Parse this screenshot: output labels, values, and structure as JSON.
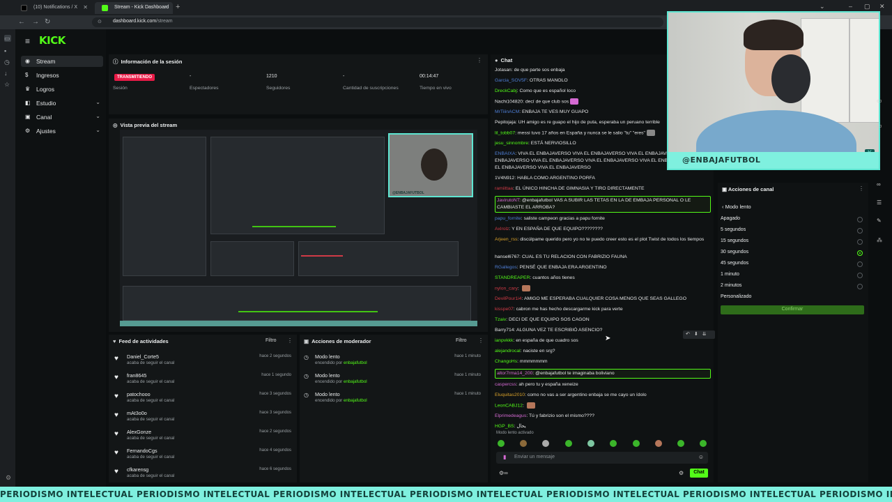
{
  "browser": {
    "tabs": [
      {
        "title": "(10) Notifications / X"
      },
      {
        "title": "Stream - Kick Dashboard"
      }
    ],
    "url_host": "dashboard.kick.com",
    "url_path": "/stream"
  },
  "brand": {
    "logo": "KICK",
    "accent": "#53fc18"
  },
  "nav": {
    "items": [
      {
        "label": "Stream",
        "icon": "broadcast-icon"
      },
      {
        "label": "Ingresos",
        "icon": "dollar-icon"
      },
      {
        "label": "Logros",
        "icon": "trophy-icon"
      },
      {
        "label": "Estudio",
        "icon": "studio-icon"
      },
      {
        "label": "Canal",
        "icon": "channel-icon"
      },
      {
        "label": "Ajustes",
        "icon": "gear-icon"
      }
    ]
  },
  "session": {
    "title": "Información de la sesión",
    "status": "TRANSMITIENDO",
    "status_label": "Sesión",
    "stats": [
      {
        "value": "-",
        "label": "Espectadores"
      },
      {
        "value": "1210",
        "label": "Seguidores"
      },
      {
        "value": "-",
        "label": "Cantidad de suscripciones"
      },
      {
        "value": "00:14:47",
        "label": "Tiempo en vivo"
      }
    ]
  },
  "preview": {
    "title": "Vista previa del stream",
    "cam_label": "@ENBAJAFUTBOL"
  },
  "feed": {
    "title": "Feed de actividades",
    "filter": "Filtro",
    "items": [
      {
        "name": "Daniel_Corte5",
        "desc": "acaba de seguir el canal",
        "time": "hace 2 segundos"
      },
      {
        "name": "fran8645",
        "desc": "acaba de seguir el canal",
        "time": "hace 1 segundo"
      },
      {
        "name": "patochooo",
        "desc": "acaba de seguir el canal",
        "time": "hace 3 segundos"
      },
      {
        "name": "mAt3o0o",
        "desc": "acaba de seguir el canal",
        "time": "hace 3 segundos"
      },
      {
        "name": "AlexGonze",
        "desc": "acaba de seguir el canal",
        "time": "hace 2 segundos"
      },
      {
        "name": "FernandoCgs",
        "desc": "acaba de seguir el canal",
        "time": "hace 4 segundos"
      },
      {
        "name": "cfkarensg",
        "desc": "acaba de seguir el canal",
        "time": "hace 6 segundos"
      }
    ]
  },
  "moderator": {
    "title": "Acciones de moderador",
    "filter": "Filtro",
    "items": [
      {
        "title": "Modo lento",
        "by_prefix": "encendido por",
        "by": "enbajafutbol",
        "time": "hace 1 minuto"
      },
      {
        "title": "Modo lento",
        "by_prefix": "encendido por",
        "by": "enbajafutbol",
        "time": "hace 1 minuto"
      },
      {
        "title": "Modo lento",
        "by_prefix": "encendido por",
        "by": "enbajafutbol",
        "time": "hace 1 minuto"
      }
    ]
  },
  "chat": {
    "title": "Chat",
    "messages": [
      {
        "user": "Jotasan",
        "color": "#e6e7e8",
        "text": "de que parte sos enbaja"
      },
      {
        "user": "Garcia_SOV5F",
        "color": "#4f7fd6",
        "text": "OTRAS MANOLO"
      },
      {
        "user": "DreckCabj",
        "color": "#53fc18",
        "text": "Como que es español loco"
      },
      {
        "user": "Nachi104820",
        "color": "#e6e7e8",
        "text": "decí de que club sos"
      },
      {
        "user": "MrTiiinACM",
        "color": "#4f7fd6",
        "text": "ENBAJA TE VES MUY GUAPO"
      },
      {
        "user": "Pepitojaja",
        "color": "#e6e7e8",
        "text": "UH amigo es re guapo el hijo de puta, esperaba un peruano terrible"
      },
      {
        "user": "lil_tobb07",
        "color": "#53fc18",
        "text": "messi tuvo 17 años en España y nunca se le salio \"tu\" \"eres\""
      },
      {
        "user": "jesu_sinnombre",
        "color": "#53fc18",
        "text": "ESTÁ NERVIOSILLO"
      },
      {
        "user": "ENBAIXA",
        "color": "#4f7fd6",
        "text": "VIVA EL ENBAJAVERSO VIVA EL ENBAJAVERSO VIVA EL ENBAJAVERSO VIVA EL ENBAJAVERSO VIVA EL ENBAJAVERSO VIVA EL ENBAJAVERSO VIVA EL ENBAJAVERSO VIVA EL ENBAJAVERSO VIVA EL ENBAJAVERSO"
      },
      {
        "user": "1V4N912",
        "color": "#e6e7e8",
        "text": "HABLA COMO ARGENTINO PORFA"
      },
      {
        "user": "ramiittaa",
        "color": "#d13a46",
        "text": "EL ÚNICO HINCHA DE GIMNASIA Y TIRO DIRECTAMENTE"
      },
      {
        "user": "JavirutoNT",
        "color": "#d46ad2",
        "text": "@enbajafutbol VAS A SUBIR LAS TETAS EN LA DE EMBAJA PERSONAL O LE CAMBIASTE EL ARROBA?"
      },
      {
        "user": "papu_fornite",
        "color": "#4f7fd6",
        "text": "saliste campeon gracias a papu fornite"
      },
      {
        "user": "Axlrolz",
        "color": "#d13a46",
        "text": "Y EN ESPAÑA DE QUE EQUIPO????????"
      },
      {
        "user": "Arjeen_rss",
        "color": "#d8a12a",
        "text": "discúlpame querido pero yo no te puedo creer esto es el plot Twist de todos los tiempos"
      },
      {
        "user": "hansel6767",
        "color": "#e6e7e8",
        "text": "CUAL ES TU RELACION CON FABRIZIO FAUNA"
      },
      {
        "user": "RGallegos",
        "color": "#4f7fd6",
        "text": "PENSÉ QUE ENBAJA ERA ARGENTINO"
      },
      {
        "user": "STANDREAPER",
        "color": "#53fc18",
        "text": "cuantos años tienes"
      },
      {
        "user": "nylon_cary",
        "color": "#d13a46",
        "text": ""
      },
      {
        "user": "DevilPour1i4",
        "color": "#d13a46",
        "text": "AMIGO ME ESPERABA CUALQUIER COSA MENOS QUE SEAS GALLEGO"
      },
      {
        "user": "kisspe07",
        "color": "#d13a46",
        "text": "cabron me has hecho descargarme kick para verte"
      },
      {
        "user": "Tzaiv",
        "color": "#53fc18",
        "text": "DECI DE QUE EQUIPO SOS CAGON"
      },
      {
        "user": "Barry714",
        "color": "#e6e7e8",
        "text": "ALGUNA VEZ TE ESCRIBIÓ ASENCIO?"
      },
      {
        "user": "ianpvkkk",
        "color": "#53fc18",
        "text": "en españa de que cuadro sos"
      },
      {
        "user": "alejandrocal",
        "color": "#53fc18",
        "text": "naciste en srg?"
      },
      {
        "user": "ChangoHs",
        "color": "#53fc18",
        "text": "mmmmmmm"
      },
      {
        "user": "altor7rma14_200",
        "color": "#d46ad2",
        "text": "@enbajafutbol te imaginaba boliviano"
      },
      {
        "user": "caspercss",
        "color": "#d46ad2",
        "text": "ah pero tu y españa xeneize"
      },
      {
        "user": "Eluquitas2010",
        "color": "#d8a12a",
        "text": "como no vas a ser argentino enbaja se me cayo un ídolo"
      },
      {
        "user": "LeonCABJ12",
        "color": "#53fc18",
        "text": ""
      },
      {
        "user": "Elprimedeagus",
        "color": "#d46ad2",
        "text": "Tú y fabrizio son el mismo????"
      },
      {
        "user": "HGP_BS",
        "color": "#53fc18",
        "text": "يحال"
      }
    ],
    "slow_mode_notice": "Modo lento activado",
    "input_placeholder": "Enviar un mensaje",
    "send_label": "Chat"
  },
  "webcam": {
    "label": "@ENBAJAFUTBOL"
  },
  "channel_actions": {
    "title": "Acciones de canal",
    "back_label": "Modo lento",
    "options": [
      {
        "label": "Apagado",
        "selected": false
      },
      {
        "label": "5 segundos",
        "selected": false
      },
      {
        "label": "15 segundos",
        "selected": false
      },
      {
        "label": "30 segundos",
        "selected": true
      },
      {
        "label": "45 segundos",
        "selected": false
      },
      {
        "label": "1 minuto",
        "selected": false
      },
      {
        "label": "2 minutos",
        "selected": false
      },
      {
        "label": "Personalizado",
        "selected": false
      }
    ],
    "confirm_label": "Confirmar"
  },
  "ticker": {
    "text": "PERIODISMO INTELECTUAL PERIODISMO INTELECTUAL PERIODISMO INTELECTUAL PERIODISMO INTELECTUAL PERIODISMO INTELECTUAL PERIODISMO INTELECTUAL PERIODISMO INTELECTUAL"
  }
}
